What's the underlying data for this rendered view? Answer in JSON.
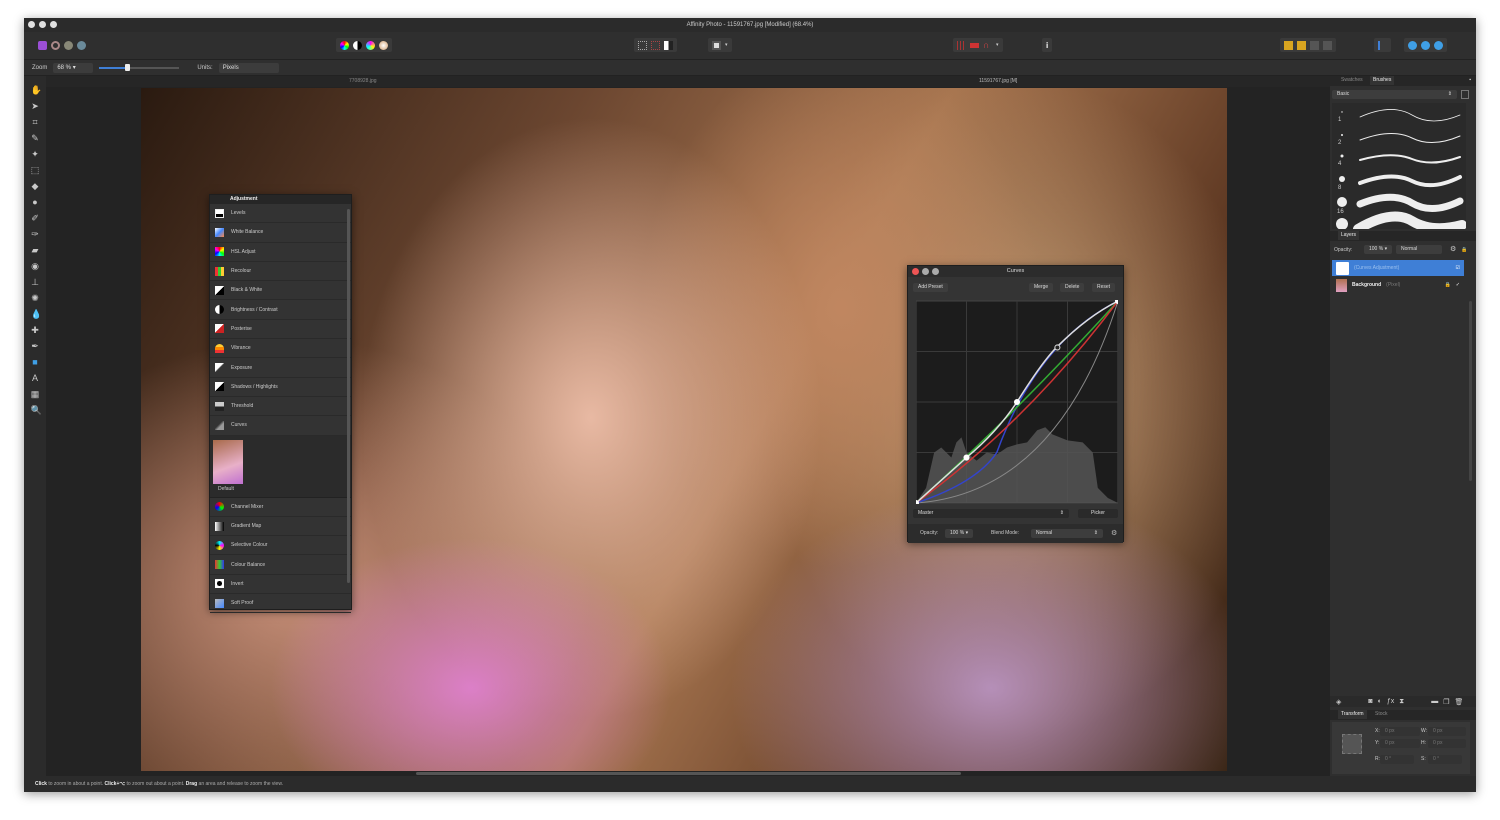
{
  "window": {
    "title": "Affinity Photo - 11591767.jpg [Modified] (68.4%)"
  },
  "context": {
    "zoom_label": "Zoom",
    "zoom_value": "68 %",
    "units_label": "Units:",
    "units_value": "Pixels"
  },
  "doc_tabs": [
    "7708928.jpg",
    "11591767.jpg [M]"
  ],
  "adjustment": {
    "title": "Adjustment",
    "items": [
      "Levels",
      "White Balance",
      "HSL Adjust",
      "Recolour",
      "Black & White",
      "Brightness / Contrast",
      "Posterise",
      "Vibrance",
      "Exposure",
      "Shadows / Highlights",
      "Threshold",
      "Curves"
    ],
    "preset_label": "Default",
    "items2": [
      "Channel Mixer",
      "Gradient Map",
      "Selective Colour",
      "Colour Balance",
      "Invert",
      "Soft Proof"
    ]
  },
  "curves": {
    "title": "Curves",
    "add_preset": "Add Preset",
    "merge": "Merge",
    "delete": "Delete",
    "reset": "Reset",
    "channel": "Master",
    "picker": "Picker",
    "opacity_label": "Opacity:",
    "opacity_value": "100 %",
    "blend_label": "Blend Mode:",
    "blend_value": "Normal"
  },
  "right": {
    "tabs": [
      "Swatches",
      "Brushes"
    ],
    "category": "Basic",
    "brush_sizes": [
      "1",
      "2",
      "4",
      "8",
      "16"
    ],
    "layers_tab": "Layers",
    "opacity_label": "Opacity:",
    "opacity_value": "100 %",
    "blend_value": "Normal",
    "layers": [
      {
        "name": "(Curves Adjustment)",
        "type": ""
      },
      {
        "name": "Background",
        "type": "(Pixel)"
      }
    ],
    "transform_tabs": [
      "Transform",
      "Stock"
    ],
    "transform": {
      "x_label": "X:",
      "x": "0 px",
      "y_label": "Y:",
      "y": "0 px",
      "w_label": "W:",
      "w": "0 px",
      "h_label": "H:",
      "h": "0 px",
      "r_label": "R:",
      "r": "0 °",
      "s_label": "S:",
      "s": "0 °"
    }
  },
  "status": {
    "b1": "Click",
    "t1": " to zoom in about a point. ",
    "b2": "Click+⌥",
    "t2": " to zoom out about a point. ",
    "b3": "Drag",
    "t3": " an area and release to zoom the view."
  },
  "colors": {
    "accent": "#3f7fd6",
    "bg": "#2e2e2e"
  }
}
